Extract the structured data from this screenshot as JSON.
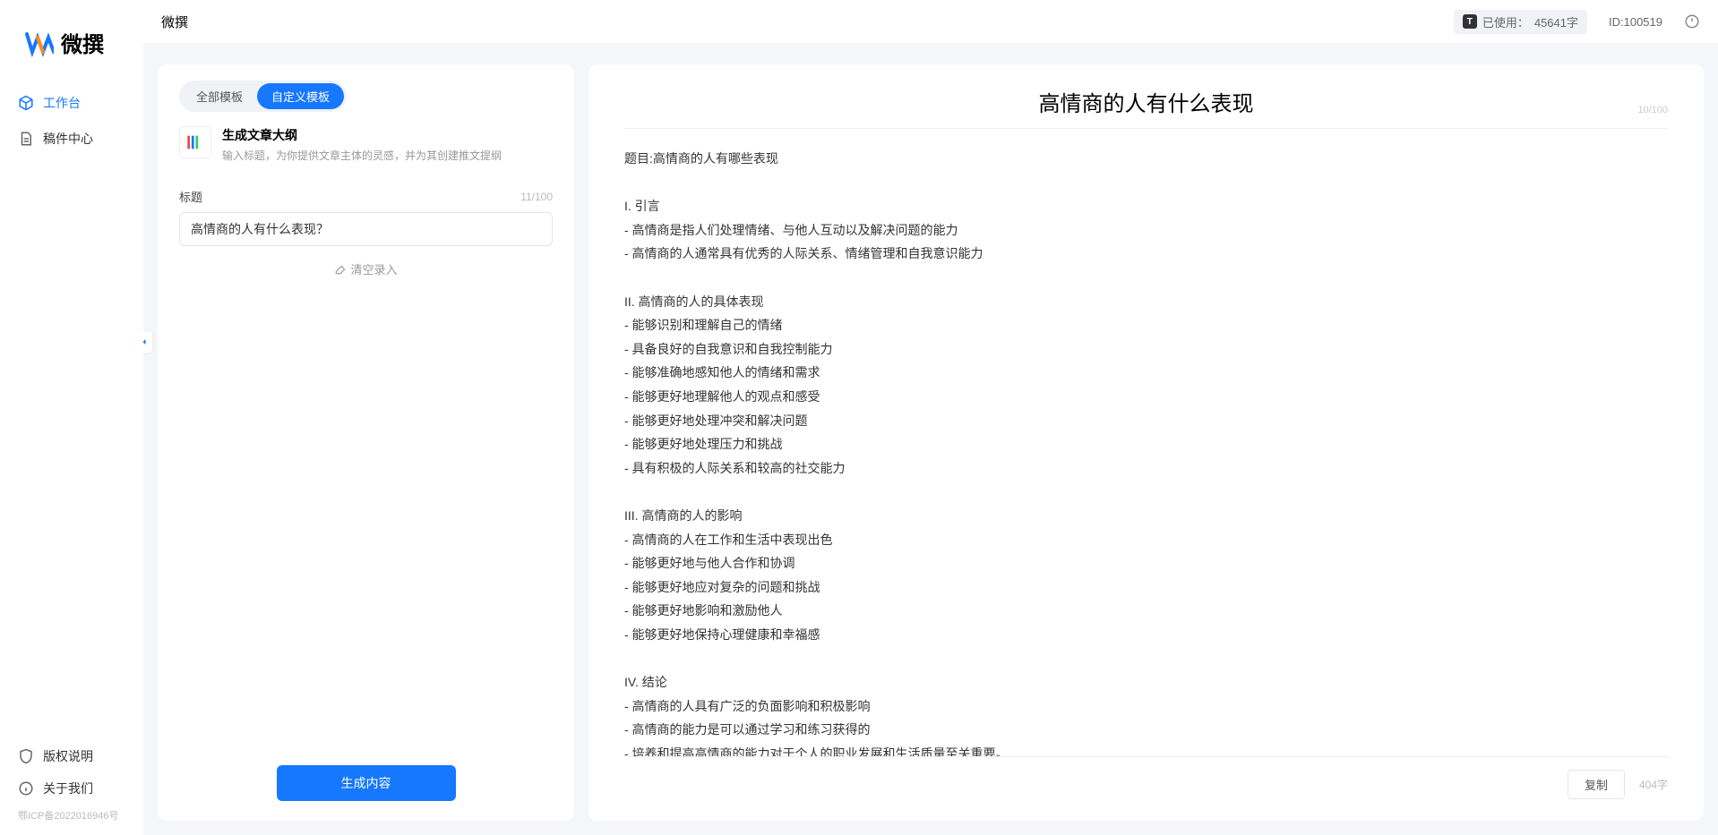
{
  "app": {
    "brand": "微撰",
    "page_title": "微撰"
  },
  "topbar": {
    "usage_label": "已使用：",
    "usage_value": "45641字",
    "user_id_label": "ID:100519"
  },
  "sidebar": {
    "items": [
      {
        "label": "工作台",
        "icon": "cube-icon",
        "active": true
      },
      {
        "label": "稿件中心",
        "icon": "doc-icon",
        "active": false
      }
    ],
    "bottom": [
      {
        "label": "版权说明",
        "icon": "shield-icon"
      },
      {
        "label": "关于我们",
        "icon": "info-icon"
      }
    ],
    "icp": "鄂ICP备2022016946号"
  },
  "left_panel": {
    "tabs": [
      {
        "label": "全部模板",
        "active": false
      },
      {
        "label": "自定义模板",
        "active": true
      }
    ],
    "template": {
      "title": "生成文章大纲",
      "desc": "输入标题，为你提供文章主体的灵感，并为其创建推文提纲"
    },
    "field": {
      "label": "标题",
      "counter": "11/100",
      "value": "高情商的人有什么表现？"
    },
    "clear_label": "清空录入",
    "generate_label": "生成内容"
  },
  "right_panel": {
    "heading": "高情商的人有什么表现",
    "heading_counter": "10/100",
    "body": "题目:高情商的人有哪些表现\n\nI. 引言\n- 高情商是指人们处理情绪、与他人互动以及解决问题的能力\n- 高情商的人通常具有优秀的人际关系、情绪管理和自我意识能力\n\nII. 高情商的人的具体表现\n- 能够识别和理解自己的情绪\n- 具备良好的自我意识和自我控制能力\n- 能够准确地感知他人的情绪和需求\n- 能够更好地理解他人的观点和感受\n- 能够更好地处理冲突和解决问题\n- 能够更好地处理压力和挑战\n- 具有积极的人际关系和较高的社交能力\n\nIII. 高情商的人的影响\n- 高情商的人在工作和生活中表现出色\n- 能够更好地与他人合作和协调\n- 能够更好地应对复杂的问题和挑战\n- 能够更好地影响和激励他人\n- 能够更好地保持心理健康和幸福感\n\nIV. 结论\n- 高情商的人具有广泛的负面影响和积极影响\n- 高情商的能力是可以通过学习和练习获得的\n- 培养和提高高情商的能力对于个人的职业发展和生活质量至关重要。",
    "copy_label": "复制",
    "word_total": "404字"
  }
}
